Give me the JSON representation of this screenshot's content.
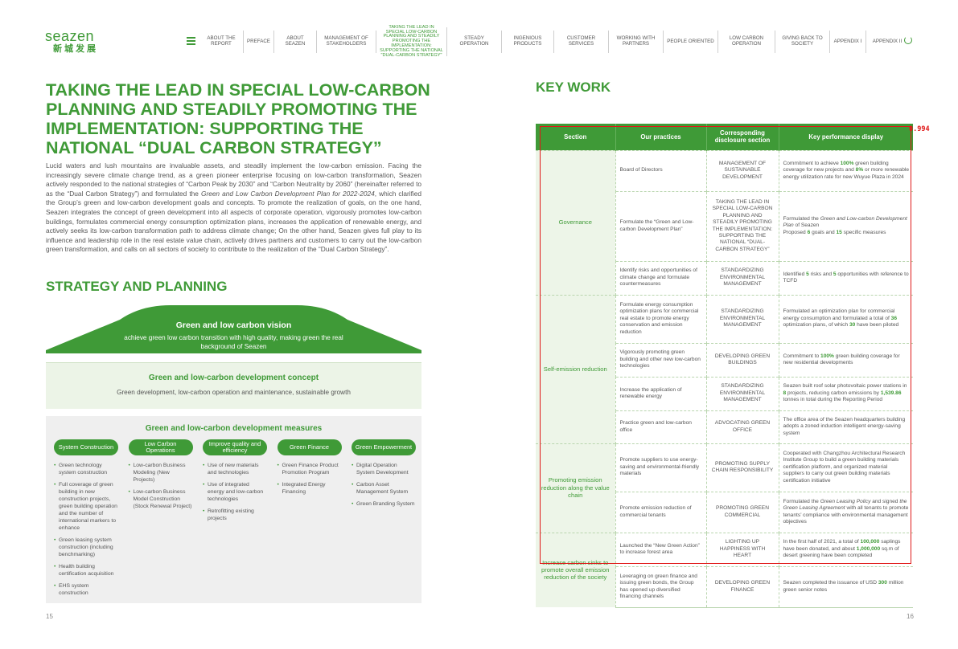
{
  "logo": {
    "en": "seazen",
    "cn": "新城发展"
  },
  "nav": [
    "ABOUT THE REPORT",
    "PREFACE",
    "ABOUT SEAZEN",
    "MANAGEMENT OF STAKEHOLDERS",
    "TAKING THE LEAD IN SPECIAL LOW-CARBON PLANNING AND STEADILY PROMOTING THE IMPLEMENTATION: SUPPORTING THE NATIONAL \"DUAL-CARBON STRATEGY\"",
    "STEADY OPERATION",
    "INGENIOUS PRODUCTS",
    "CUSTOMER SERVICES",
    "WORKING WITH PARTNERS",
    "PEOPLE ORIENTED",
    "LOW CARBON OPERATION",
    "GIVING BACK TO SOCIETY",
    "APPENDIX I",
    "APPENDIX II"
  ],
  "left": {
    "title": "TAKING THE LEAD IN SPECIAL LOW-CARBON PLANNING AND STEADILY PROMOTING THE IMPLEMENTATION: SUPPORTING THE NATIONAL “DUAL CARBON STRATEGY”",
    "intro": {
      "p1": "Lucid waters and lush mountains are invaluable assets, and steadily implement the low-carbon emission. Facing the increasingly severe climate change trend, as a green pioneer enterprise focusing on low-carbon transformation, Seazen actively responded to the national strategies of “Carbon Peak by 2030” and “Carbon Neutrality by 2060” (hereinafter referred to as the “Dual Carbon Strategy”) and formulated the ",
      "em": "Green and Low Carbon Development Plan for 2022-2024",
      "p2": ", which clarified the Group’s green and low-carbon development goals and concepts. To promote the realization of goals, on the one hand, Seazen integrates the concept of green development into all aspects of corporate operation, vigorously promotes low-carbon buildings, formulates commercial energy consumption optimization plans, increases the application of renewable energy, and actively seeks its low-carbon transformation path to address climate change; On the other hand, Seazen gives full play to its influence and leadership role in the real estate value chain, actively drives partners and customers to carry out the low-carbon green transformation, and calls on all sectors of society to contribute to the realization of the “Dual Carbon Strategy”."
    },
    "strategy_title": "STRATEGY AND PLANNING",
    "vision": {
      "title": "Green and low carbon vision",
      "sub": "achieve green low carbon transition with high quality, making green the real background of Seazen"
    },
    "concept": {
      "title": "Green and low-carbon development concept",
      "sub": "Green development, low-carbon operation and maintenance, sustainable growth"
    },
    "measures": {
      "title": "Green and low-carbon development measures",
      "columns": [
        {
          "label": "System Construction",
          "items": [
            "Green technology system construction",
            "Full coverage of green building in new construction projects, green building operation and the number of international markers to enhance",
            "Green leasing system construction (including benchmarking)",
            "Health building certification acquisition",
            "EHS system construction"
          ]
        },
        {
          "label": "Low Carbon Operations",
          "items": [
            "Low-carbon Business Modeling (New Projects)",
            "Low-carbon Business Model Construction (Stock Renewal Project)"
          ]
        },
        {
          "label": "Improve quality and efficiency",
          "items": [
            "Use of new materials and technologies",
            "Use of integrated energy and low-carbon technologies",
            "Retrofitting existing projects"
          ]
        },
        {
          "label": "Green Finance",
          "items": [
            "Green Finance Product Promotion Program",
            "Integrated Energy Financing"
          ]
        },
        {
          "label": "Green Empowerment",
          "items": [
            "Digital Operation System Development",
            "Carbon Asset Management System",
            "Green Branding System"
          ]
        }
      ]
    },
    "page": "15"
  },
  "right": {
    "title": "KEY WORK",
    "headers": [
      "Section",
      "Our practices",
      "Corresponding disclosure section",
      "Key performance display"
    ],
    "sections": {
      "governance": "Governance",
      "self": "Self-emission reduction",
      "value": "Promoting emission reduction along the value chain",
      "sinks": "Increase carbon sinks to promote overall emission reduction of the society"
    },
    "rows": [
      {
        "practice": "Board of Directors",
        "disclosure": "MANAGEMENT OF SUSTAINABLE DEVELOPMENT"
      },
      {
        "practice": "Formulate the “Green and Low-carbon Development Plan”",
        "disclosure": "TAKING THE LEAD IN SPECIAL LOW-CARBON PLANNING AND STEADILY PROMOTING THE IMPLEMENTATION: SUPPORTING THE NATIONAL “DUAL-CARBON STRATEGY”"
      },
      {
        "practice": "Identify risks and opportunities of climate change and formulate countermeasures",
        "disclosure": "STANDARDIZING ENVIRONMENTAL MANAGEMENT"
      },
      {
        "practice": "Formulate energy consumption optimization plans for commercial real estate to promote energy conservation and emission reduction",
        "disclosure": "STANDARDIZING ENVIRONMENTAL MANAGEMENT"
      },
      {
        "practice": "Vigorously promoting green building and other new low-carbon technologies",
        "disclosure": "DEVELOPING GREEN BUILDINGS"
      },
      {
        "practice": "Increase the application of renewable energy",
        "disclosure": "STANDARDIZING ENVIRONMENTAL MANAGEMENT"
      },
      {
        "practice": "Practice green and low-carbon office",
        "disclosure": "ADVOCATING GREEN OFFICE"
      },
      {
        "practice": "Promote suppliers to use energy-saving and environmental-friendly materials",
        "disclosure": "PROMOTING SUPPLY CHAIN RESPONSIBILITY"
      },
      {
        "practice": "Promote emission reduction of commercial tenants",
        "disclosure": "PROMOTING GREEN COMMERCIAL"
      },
      {
        "practice": "Launched the “New Green Action” to increase forest area",
        "disclosure": "LIGHTING UP HAPPINESS WITH HEART"
      },
      {
        "practice": "Leveraging on green finance and issuing green bonds, the Group has opened up diversified financing channels",
        "disclosure": "DEVELOPING GREEN FINANCE"
      }
    ],
    "kpi": {
      "r1": {
        "a": "Commitment to achieve ",
        "b": "100%",
        "c": " green building coverage for new projects and ",
        "d": "8%",
        "e": " or more renewable energy utilization rate for new Wuyue Plaza in 2024"
      },
      "r2": {
        "a": "Formulated the ",
        "em": "Green and Low-carbon Development Plan",
        "b": " of Seazen",
        "c": "Proposed ",
        "d": "6",
        "e": " goals and ",
        "f": "15",
        "g": " specific measures"
      },
      "r3": {
        "a": "Identified ",
        "b": "5",
        "c": " risks and ",
        "d": "5",
        "e": " opportunities with reference to TCFD"
      },
      "r4": {
        "a": "Formulated an optimization plan for commercial energy consumption and formulated a total of ",
        "b": "36",
        "c": " optimization plans, of which ",
        "d": "30",
        "e": " have been piloted"
      },
      "r5": {
        "a": "Commitment to ",
        "b": "100%",
        "c": " green building coverage for new residential developments"
      },
      "r6": {
        "a": "Seazen built roof solar photovoltaic power stations in ",
        "b": "8",
        "c": " projects, reducing carbon emissions by ",
        "d": "1,539.86",
        "e": " tonnes in total during the Reporting Period"
      },
      "r7": {
        "a": "The office area of the Seazen headquarters building adopts a zoned induction intelligent energy-saving system"
      },
      "r8": {
        "a": "Cooperated with Changzhou Architectural Research Institute Group to build a green building materials certification platform, and organized material suppliers to carry out green building materials certification initiative"
      },
      "r9": {
        "a": "Formulated the ",
        "em1": "Green Leasing Policy",
        "b": " and signed ",
        "em2": "the Green Leasing Agreement",
        "c": " with all tenants to promote tenants’ compliance with environmental management objectives"
      },
      "r10": {
        "a": "In the first half of 2021, a total of ",
        "b": "100,000",
        "c": " saplings have been donated, and about ",
        "d": "1,000,000",
        "e": " sq.m of desert greening have been completed"
      },
      "r11": {
        "a": "Seazen completed the issuance of USD ",
        "b": "300",
        "c": " million green senior notes"
      }
    },
    "page": "16"
  },
  "overlay": {
    "score": "0.994"
  },
  "colors": {
    "brand_green": "#3f9a37",
    "light_green": "#edf5e8",
    "overlay_red": "#e01818"
  }
}
